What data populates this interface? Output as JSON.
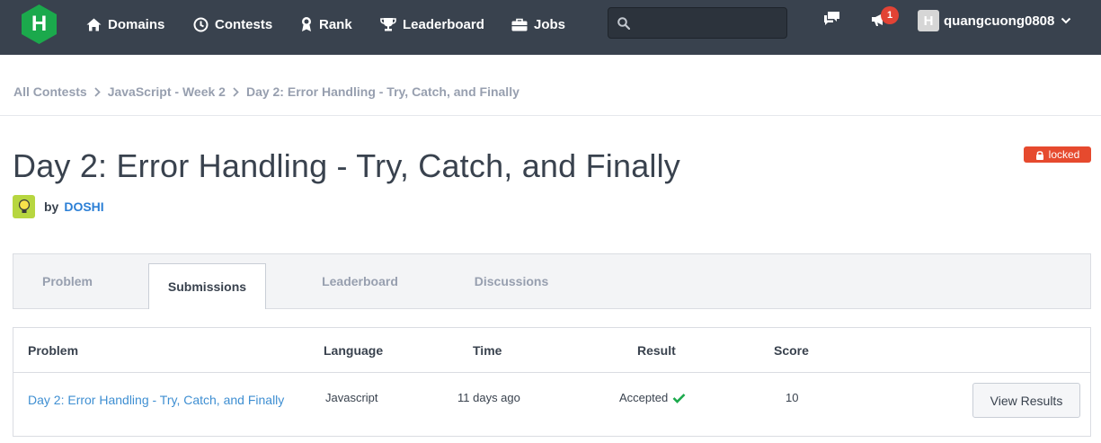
{
  "nav": {
    "logo_letter": "H",
    "items": [
      {
        "label": "Domains",
        "icon": "home-icon"
      },
      {
        "label": "Contests",
        "icon": "clock-icon"
      },
      {
        "label": "Rank",
        "icon": "award-icon"
      },
      {
        "label": "Leaderboard",
        "icon": "trophy-icon"
      },
      {
        "label": "Jobs",
        "icon": "briefcase-icon"
      }
    ],
    "search": {
      "placeholder": "",
      "value": ""
    },
    "notification_count": "1",
    "user": {
      "avatar_letter": "H",
      "username": "quangcuong0808"
    }
  },
  "breadcrumb": [
    "All Contests",
    "JavaScript - Week 2",
    "Day 2: Error Handling - Try, Catch, and Finally"
  ],
  "challenge": {
    "title": "Day 2: Error Handling - Try, Catch, and Finally",
    "by_label": "by",
    "author": "DOSHI",
    "status_badge": "locked"
  },
  "tabs": [
    {
      "label": "Problem",
      "active": false
    },
    {
      "label": "Submissions",
      "active": true
    },
    {
      "label": "Leaderboard",
      "active": false
    },
    {
      "label": "Discussions",
      "active": false
    }
  ],
  "table": {
    "headers": [
      "Problem",
      "Language",
      "Time",
      "Result",
      "Score"
    ],
    "rows": [
      {
        "problem": "Day 2: Error Handling - Try, Catch, and Finally",
        "language": "Javascript",
        "time": "11 days ago",
        "result": "Accepted",
        "score": "10",
        "action": "View Results"
      }
    ]
  },
  "colors": {
    "nav_bg": "#39424e",
    "brand_green": "#1ba94c",
    "link_blue": "#3f8fd2",
    "badge_red": "#e64a2e",
    "accepted_green": "#1ba94c"
  }
}
